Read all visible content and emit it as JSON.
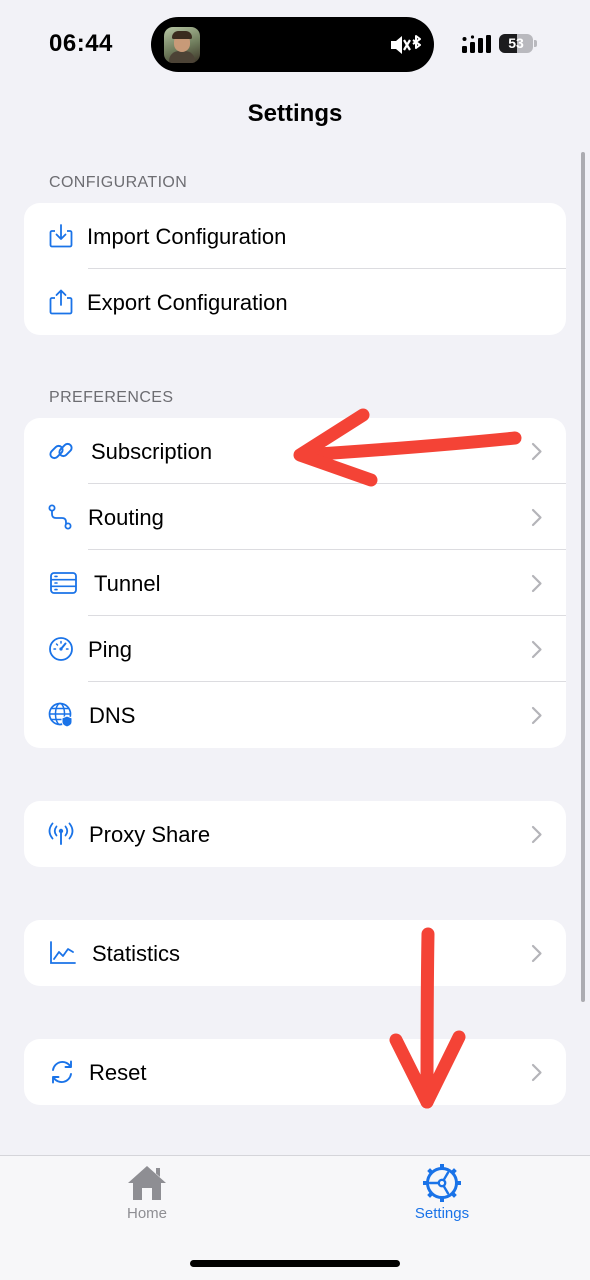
{
  "status_bar": {
    "time": "06:44",
    "battery_level": "53"
  },
  "nav": {
    "title": "Settings"
  },
  "sections": {
    "configuration": {
      "header": "CONFIGURATION",
      "items": [
        {
          "label": "Import Configuration",
          "icon": "import-icon"
        },
        {
          "label": "Export Configuration",
          "icon": "export-icon"
        }
      ]
    },
    "preferences": {
      "header": "PREFERENCES",
      "items": [
        {
          "label": "Subscription",
          "icon": "link-icon"
        },
        {
          "label": "Routing",
          "icon": "route-icon"
        },
        {
          "label": "Tunnel",
          "icon": "server-icon"
        },
        {
          "label": "Ping",
          "icon": "speedometer-icon"
        },
        {
          "label": "DNS",
          "icon": "globe-shield-icon"
        }
      ]
    },
    "proxy_share": {
      "label": "Proxy Share",
      "icon": "antenna-icon"
    },
    "statistics": {
      "label": "Statistics",
      "icon": "chart-icon"
    },
    "reset": {
      "label": "Reset",
      "icon": "refresh-icon"
    }
  },
  "tab_bar": {
    "tabs": [
      {
        "label": "Home",
        "icon": "house-icon",
        "active": false
      },
      {
        "label": "Settings",
        "icon": "gear-icon",
        "active": true
      }
    ]
  },
  "colors": {
    "accent": "#1a73e8",
    "background": "#f2f2f7",
    "annotation_arrow": "#f44336"
  }
}
